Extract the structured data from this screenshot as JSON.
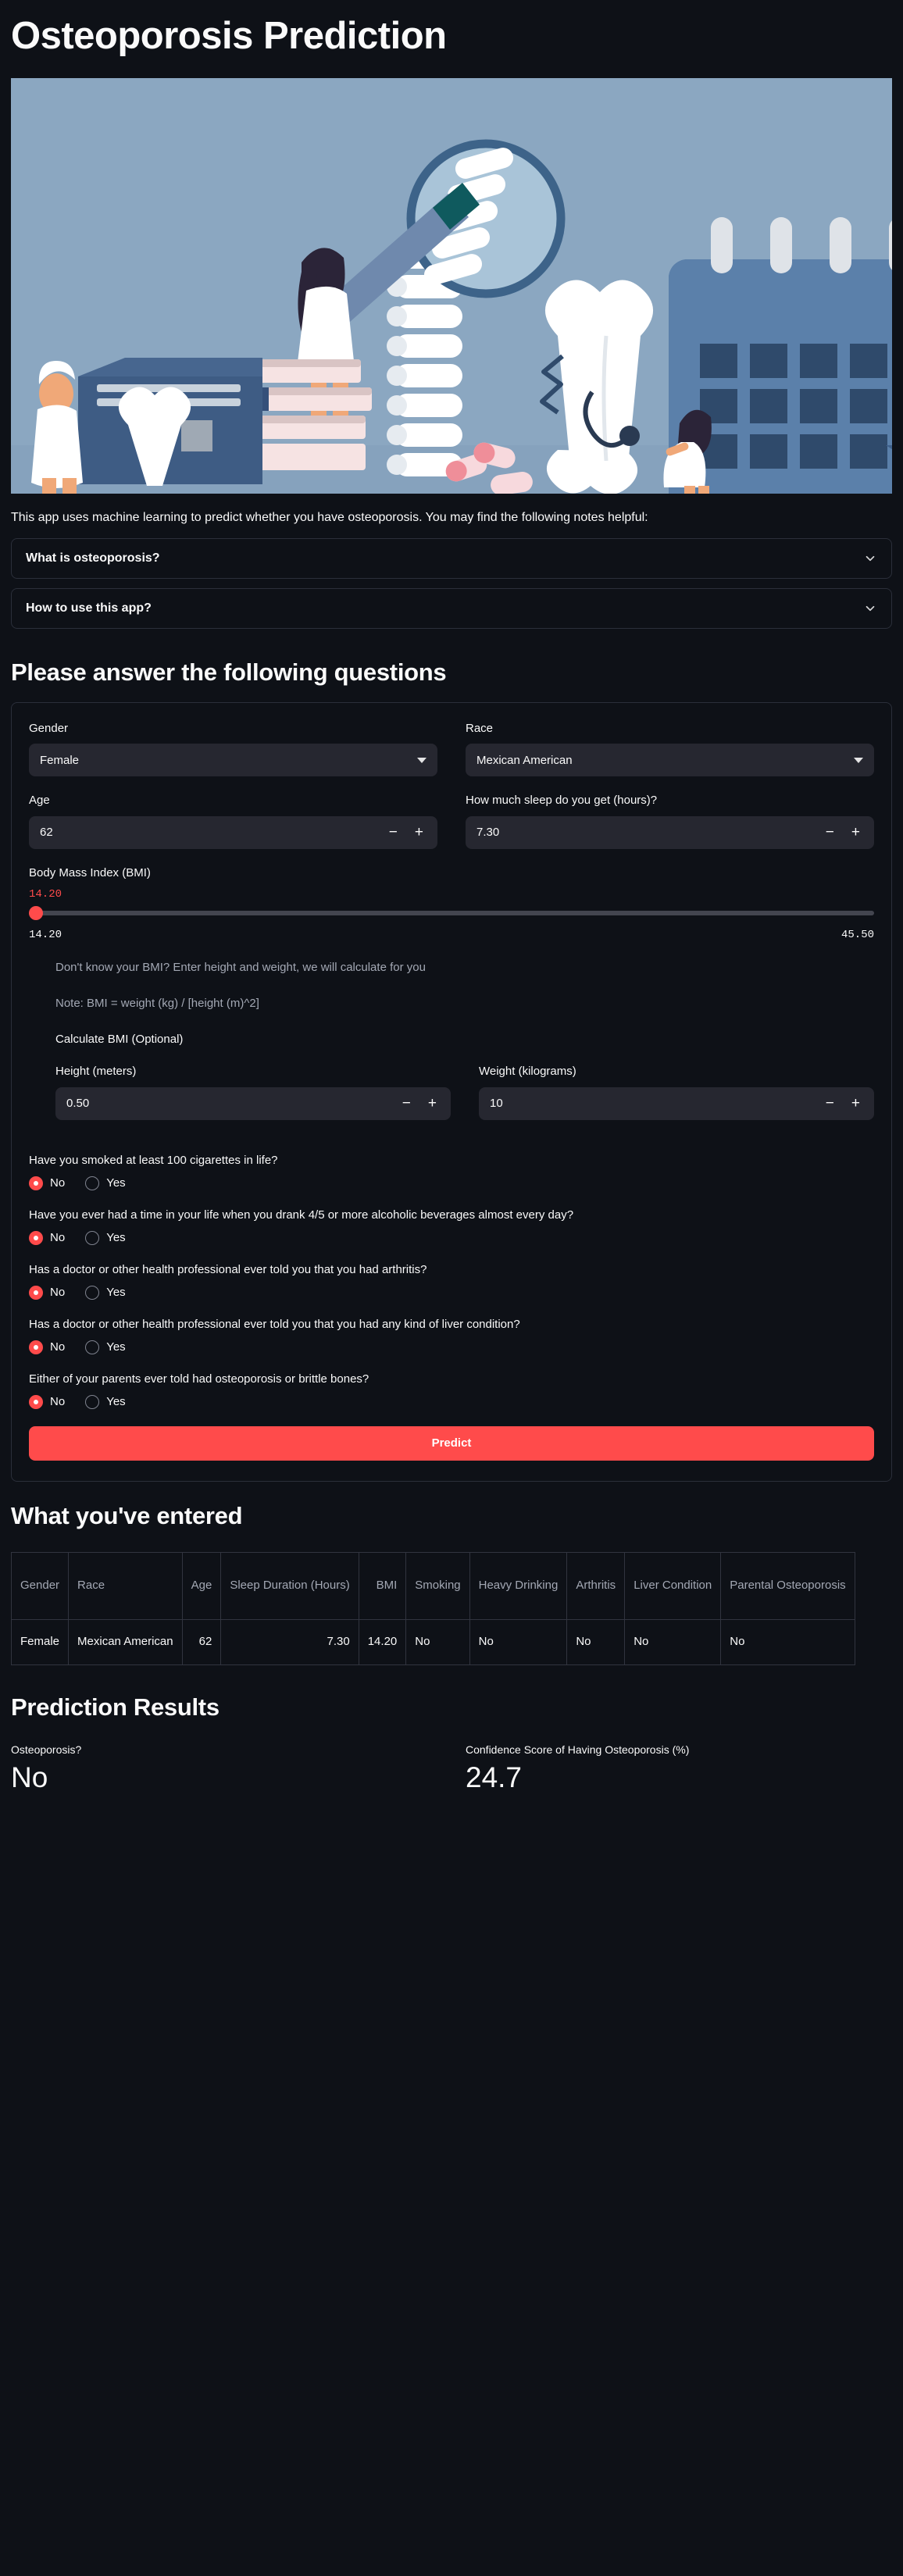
{
  "app": {
    "title": "Osteoporosis Prediction",
    "intro": "This app uses machine learning to predict whether you have osteoporosis. You may find the following notes helpful:"
  },
  "colors": {
    "accent": "#ff4b4b",
    "background": "#0e1117",
    "widget_background": "#262730",
    "text": "#fafafa",
    "muted_text": "#a3a8b4",
    "border": "#2b2f3a"
  },
  "expanders": [
    {
      "label": "What is osteoporosis?",
      "icon": "chevron-down-icon",
      "expanded": false
    },
    {
      "label": "How to use this app?",
      "icon": "chevron-down-icon",
      "expanded": false
    }
  ],
  "form": {
    "heading": "Please answer the following questions",
    "gender": {
      "label": "Gender",
      "value": "Female"
    },
    "race": {
      "label": "Race",
      "value": "Mexican American"
    },
    "age": {
      "label": "Age",
      "value": "62"
    },
    "sleep": {
      "label": "How much sleep do you get (hours)?",
      "value": "7.30"
    },
    "bmi": {
      "label": "Body Mass Index (BMI)",
      "value": "14.20",
      "min": "14.20",
      "max": "45.50",
      "percent": 0
    },
    "bmi_help": {
      "hint": "Don't know your BMI? Enter height and weight, we will calculate for you",
      "note": "Note: BMI = weight (kg) / [height (m)^2]",
      "calc_label": "Calculate BMI (Optional)",
      "height": {
        "label": "Height (meters)",
        "value": "0.50"
      },
      "weight": {
        "label": "Weight (kilograms)",
        "value": "10"
      }
    },
    "stepper": {
      "minus": "−",
      "plus": "+"
    },
    "questions": [
      {
        "name": "smoking",
        "text": "Have you smoked at least 100 cigarettes in life?",
        "options": [
          "No",
          "Yes"
        ],
        "selected": "No"
      },
      {
        "name": "heavy-drinking",
        "text": "Have you ever had a time in your life when you drank 4/5 or more alcoholic beverages almost every day?",
        "options": [
          "No",
          "Yes"
        ],
        "selected": "No"
      },
      {
        "name": "arthritis",
        "text": "Has a doctor or other health professional ever told you that you had arthritis?",
        "options": [
          "No",
          "Yes"
        ],
        "selected": "No"
      },
      {
        "name": "liver-condition",
        "text": "Has a doctor or other health professional ever told you that you had any kind of liver condition?",
        "options": [
          "No",
          "Yes"
        ],
        "selected": "No"
      },
      {
        "name": "parental-osteoporosis",
        "text": "Either of your parents ever told had osteoporosis or brittle bones?",
        "options": [
          "No",
          "Yes"
        ],
        "selected": "No"
      }
    ],
    "submit_label": "Predict"
  },
  "entered": {
    "heading": "What you've entered",
    "columns": [
      {
        "label": "Gender",
        "align": "left"
      },
      {
        "label": "Race",
        "align": "left"
      },
      {
        "label": "Age",
        "align": "right"
      },
      {
        "label": "Sleep Duration (Hours)",
        "align": "right"
      },
      {
        "label": "BMI",
        "align": "right"
      },
      {
        "label": "Smoking",
        "align": "left"
      },
      {
        "label": "Heavy Drinking",
        "align": "left"
      },
      {
        "label": "Arthritis",
        "align": "left"
      },
      {
        "label": "Liver Condition",
        "align": "left"
      },
      {
        "label": "Parental Osteoporosis",
        "align": "left"
      }
    ],
    "rows": [
      [
        "Female",
        "Mexican American",
        "62",
        "7.30",
        "14.20",
        "No",
        "No",
        "No",
        "No",
        "No"
      ]
    ]
  },
  "results": {
    "heading": "Prediction Results",
    "metrics": [
      {
        "label": "Osteoporosis?",
        "value": "No"
      },
      {
        "label": "Confidence Score of Having Osteoporosis (%)",
        "value": "24.7"
      }
    ]
  }
}
